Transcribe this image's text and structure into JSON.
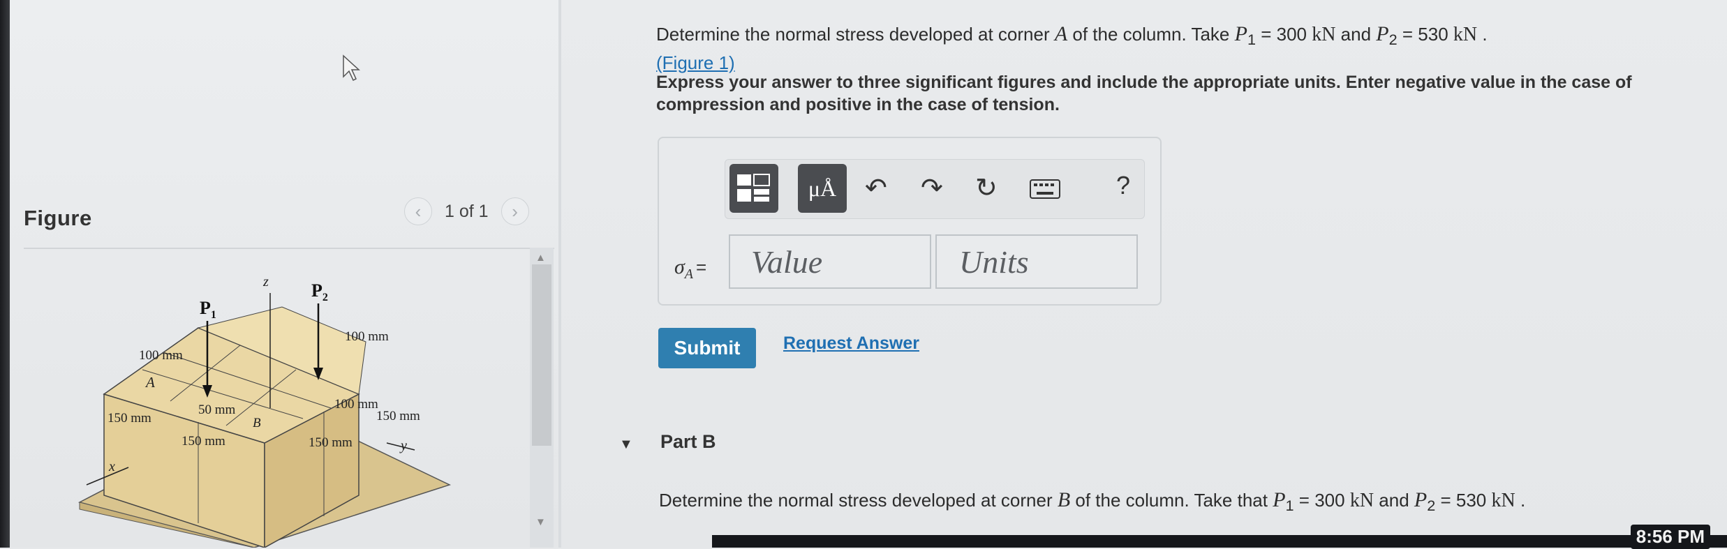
{
  "figure": {
    "title": "Figure",
    "pager": {
      "prev": "‹",
      "count": "1 of 1",
      "next": "›"
    },
    "labels": {
      "p1": "P",
      "p1_sub": "1",
      "p2": "P",
      "p2_sub": "2",
      "z": "z",
      "x": "x",
      "y": "y",
      "a": "A",
      "b": "B",
      "d100_top_left": "100 mm",
      "d100_top_right": "100 mm",
      "d150_left": "150 mm",
      "d50": "50 mm",
      "d100_mid": "100 mm",
      "d150_right_top": "150 mm",
      "d150_bottom_left": "150 mm",
      "d150_bottom_right": "150 mm"
    }
  },
  "question": {
    "part_a": {
      "text_before_a": "Determine the normal stress developed at corner ",
      "corner": "A",
      "text_mid": " of the column. Take ",
      "p1_sym": "P",
      "p1_sub": "1",
      "p1_val": " = 300 ",
      "unit1": "kN",
      "and": " and ",
      "p2_sym": "P",
      "p2_sub": "2",
      "p2_val": " = 530 ",
      "unit2": "kN",
      "end": " .",
      "figure_link": "(Figure 1)",
      "instructions": "Express your answer to three significant figures and include the appropriate units. Enter negative value in the case of compression and positive in the case of tension."
    },
    "answer": {
      "sigma": "σ",
      "sigma_sub": "A",
      "equals": "=",
      "value_placeholder": "Value",
      "units_placeholder": "Units",
      "help": "?"
    },
    "submit_label": "Submit",
    "request_label": "Request Answer",
    "part_b": {
      "label": "Part B",
      "text_before": "Determine the normal stress developed at corner ",
      "corner": "B",
      "text_mid": " of the column. Take that ",
      "p1_sym": "P",
      "p1_sub": "1",
      "p1_val": " = 300 ",
      "unit1": "kN",
      "and": " and ",
      "p2_sym": "P",
      "p2_sub": "2",
      "p2_val": " = 530 ",
      "unit2": "kN",
      "end": " ."
    }
  },
  "taskbar": {
    "clock": "8:56 PM"
  },
  "colors": {
    "link": "#1f6fb2",
    "submit": "#2f7fb0",
    "block": "#d8c088"
  }
}
